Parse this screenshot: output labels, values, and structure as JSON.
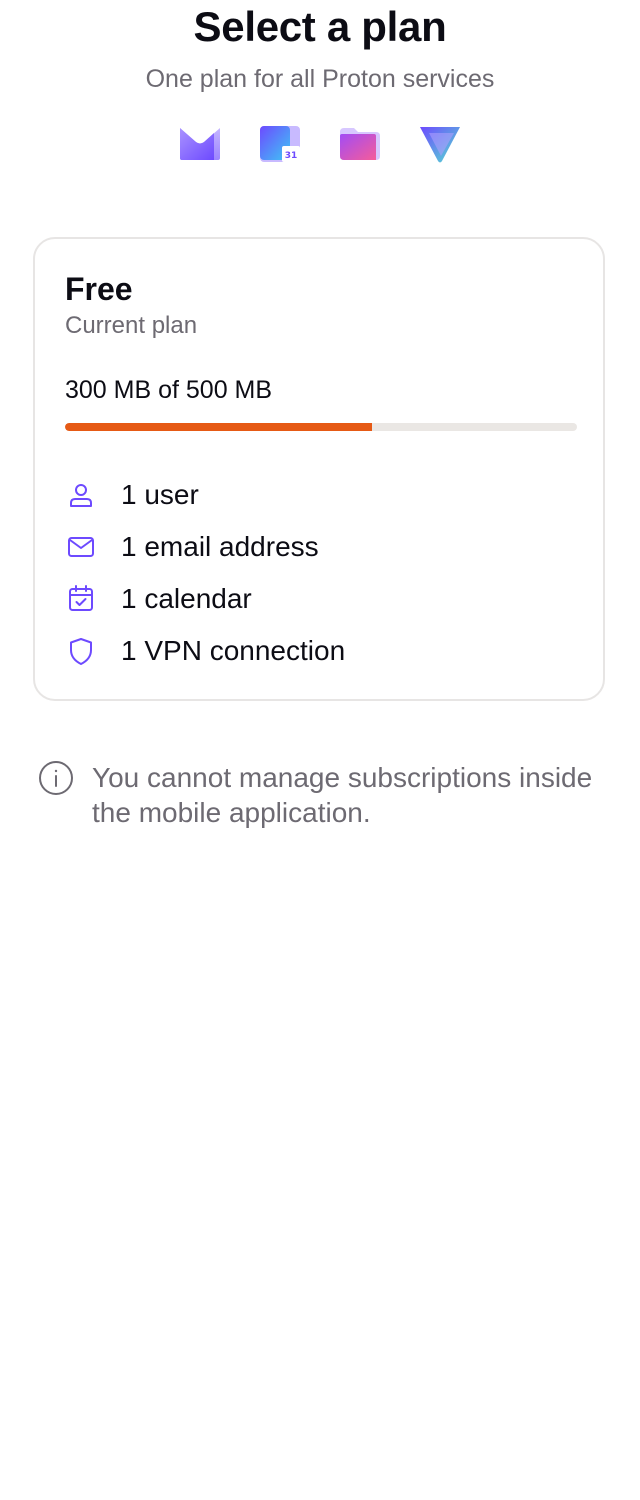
{
  "header": {
    "title": "Select a plan",
    "subtitle": "One plan for all Proton services"
  },
  "products": [
    {
      "icon": "proton-mail-icon"
    },
    {
      "icon": "proton-calendar-icon",
      "badge": "31"
    },
    {
      "icon": "proton-drive-icon"
    },
    {
      "icon": "proton-vpn-icon"
    }
  ],
  "plan": {
    "name": "Free",
    "status": "Current plan",
    "storage_text": "300 MB of 500 MB",
    "storage_used_percent": 60,
    "features": [
      {
        "icon": "user-icon",
        "label": "1 user"
      },
      {
        "icon": "envelope-icon",
        "label": "1 email address"
      },
      {
        "icon": "calendar-check-icon",
        "label": "1 calendar"
      },
      {
        "icon": "shield-icon",
        "label": "1 VPN connection"
      }
    ]
  },
  "notice": {
    "icon": "info-icon",
    "text": "You cannot manage subscriptions inside the mobile application."
  },
  "colors": {
    "accent": "#6d4aff",
    "progress": "#e65a15",
    "progress_track": "#eae7e4",
    "muted_text": "#6d6a72"
  }
}
